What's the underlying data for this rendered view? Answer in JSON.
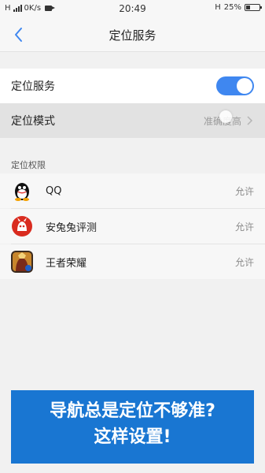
{
  "status_bar": {
    "signal_text": "H",
    "net_speed": "0K/s",
    "time": "20:49",
    "network_type": "H",
    "battery": "25%"
  },
  "nav": {
    "back_icon": "chevron-left-icon",
    "title": "定位服务"
  },
  "settings": {
    "location_service_label": "定位服务",
    "location_service_on": true,
    "location_mode_label": "定位模式",
    "location_mode_value": "准确度高"
  },
  "permissions": {
    "section_title": "定位权限",
    "apps": [
      {
        "name": "QQ",
        "status": "允许",
        "icon": "qq-penguin-icon"
      },
      {
        "name": "安兔兔评测",
        "status": "允许",
        "icon": "antutu-icon"
      },
      {
        "name": "王者荣耀",
        "status": "允许",
        "icon": "honor-of-kings-icon"
      }
    ]
  },
  "banner": {
    "line1": "导航总是定位不够准?",
    "line2": "这样设置!"
  },
  "colors": {
    "accent": "#3f87f0",
    "banner": "#1976d2"
  }
}
